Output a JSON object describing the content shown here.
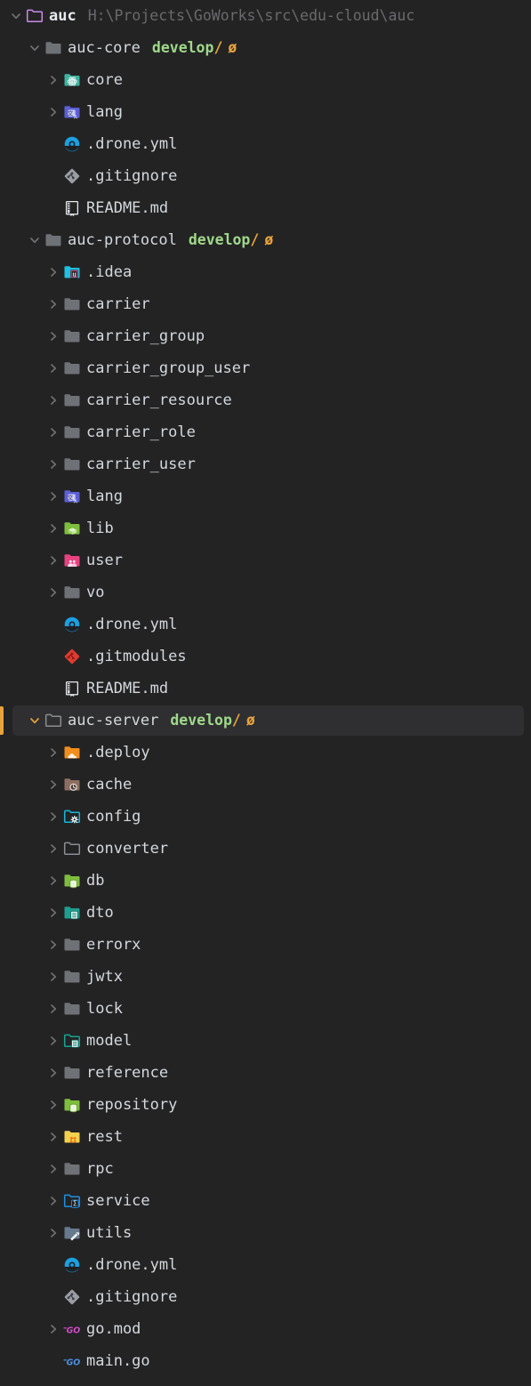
{
  "theme": {
    "background": "#232324",
    "selection_background": "#2F2F31",
    "selection_marker": "#E8A33D",
    "text": "#D5D8DC",
    "path_text": "#6A6A6C",
    "branch_name": "#9FD88A",
    "branch_slash": "#E8A33D",
    "chevron": "#707070"
  },
  "root": {
    "label": "auc",
    "path": "H:\\Projects\\GoWorks\\src\\edu-cloud\\auc",
    "icon": "folder-outline-purple-icon",
    "expanded": true
  },
  "branch_marker": "ø",
  "branch_separator": "/",
  "rows": [
    {
      "label": "auc",
      "path": "H:\\Projects\\GoWorks\\src\\edu-cloud\\auc",
      "indent": 0,
      "state": "expanded",
      "icon": "folder-outline-purple-icon",
      "bold": true,
      "selected": false
    },
    {
      "label": "auc-core",
      "branch": "develop",
      "indent": 1,
      "state": "expanded",
      "icon": "folder-gray-icon",
      "selected": false
    },
    {
      "label": "core",
      "indent": 2,
      "state": "collapsed",
      "icon": "folder-teal-atom-icon",
      "selected": false
    },
    {
      "label": "lang",
      "indent": 2,
      "state": "collapsed",
      "icon": "folder-indigo-translate-icon",
      "selected": false
    },
    {
      "label": ".drone.yml",
      "indent": 2,
      "state": "leaf",
      "icon": "drone-yml-icon",
      "selected": false
    },
    {
      "label": ".gitignore",
      "indent": 2,
      "state": "leaf",
      "icon": "git-gray-icon",
      "selected": false
    },
    {
      "label": "README.md",
      "indent": 2,
      "state": "leaf",
      "icon": "readme-book-icon",
      "selected": false
    },
    {
      "label": "auc-protocol",
      "branch": "develop",
      "indent": 1,
      "state": "expanded",
      "icon": "folder-gray-icon",
      "selected": false
    },
    {
      "label": ".idea",
      "indent": 2,
      "state": "collapsed",
      "icon": "folder-intellij-icon",
      "selected": false
    },
    {
      "label": "carrier",
      "indent": 2,
      "state": "collapsed",
      "icon": "folder-gray-icon",
      "selected": false
    },
    {
      "label": "carrier_group",
      "indent": 2,
      "state": "collapsed",
      "icon": "folder-gray-icon",
      "selected": false
    },
    {
      "label": "carrier_group_user",
      "indent": 2,
      "state": "collapsed",
      "icon": "folder-gray-icon",
      "selected": false
    },
    {
      "label": "carrier_resource",
      "indent": 2,
      "state": "collapsed",
      "icon": "folder-gray-icon",
      "selected": false
    },
    {
      "label": "carrier_role",
      "indent": 2,
      "state": "collapsed",
      "icon": "folder-gray-icon",
      "selected": false
    },
    {
      "label": "carrier_user",
      "indent": 2,
      "state": "collapsed",
      "icon": "folder-gray-icon",
      "selected": false
    },
    {
      "label": "lang",
      "indent": 2,
      "state": "collapsed",
      "icon": "folder-indigo-translate-icon",
      "selected": false
    },
    {
      "label": "lib",
      "indent": 2,
      "state": "collapsed",
      "icon": "folder-green-lib-icon",
      "selected": false
    },
    {
      "label": "user",
      "indent": 2,
      "state": "collapsed",
      "icon": "folder-pink-user-icon",
      "selected": false
    },
    {
      "label": "vo",
      "indent": 2,
      "state": "collapsed",
      "icon": "folder-gray-icon",
      "selected": false
    },
    {
      "label": ".drone.yml",
      "indent": 2,
      "state": "leaf",
      "icon": "drone-yml-icon",
      "selected": false
    },
    {
      "label": ".gitmodules",
      "indent": 2,
      "state": "leaf",
      "icon": "git-red-icon",
      "selected": false
    },
    {
      "label": "README.md",
      "indent": 2,
      "state": "leaf",
      "icon": "readme-book-icon",
      "selected": false
    },
    {
      "label": "auc-server",
      "branch": "develop",
      "indent": 1,
      "state": "expanded",
      "icon": "folder-outline-gray-icon",
      "selected": true
    },
    {
      "label": ".deploy",
      "indent": 2,
      "state": "collapsed",
      "icon": "folder-orange-cloud-icon",
      "selected": false
    },
    {
      "label": "cache",
      "indent": 2,
      "state": "collapsed",
      "icon": "folder-brown-clock-icon",
      "selected": false
    },
    {
      "label": "config",
      "indent": 2,
      "state": "collapsed",
      "icon": "folder-cyan-gear-icon",
      "selected": false
    },
    {
      "label": "converter",
      "indent": 2,
      "state": "collapsed",
      "icon": "folder-outline-gray-icon",
      "selected": false
    },
    {
      "label": "db",
      "indent": 2,
      "state": "collapsed",
      "icon": "folder-green-db-icon",
      "selected": false
    },
    {
      "label": "dto",
      "indent": 2,
      "state": "collapsed",
      "icon": "folder-teal-card-icon",
      "selected": false
    },
    {
      "label": "errorx",
      "indent": 2,
      "state": "collapsed",
      "icon": "folder-gray-icon",
      "selected": false
    },
    {
      "label": "jwtx",
      "indent": 2,
      "state": "collapsed",
      "icon": "folder-gray-icon",
      "selected": false
    },
    {
      "label": "lock",
      "indent": 2,
      "state": "collapsed",
      "icon": "folder-gray-icon",
      "selected": false
    },
    {
      "label": "model",
      "indent": 2,
      "state": "collapsed",
      "icon": "folder-teal-outline-card-icon",
      "selected": false
    },
    {
      "label": "reference",
      "indent": 2,
      "state": "collapsed",
      "icon": "folder-gray-icon",
      "selected": false
    },
    {
      "label": "repository",
      "indent": 2,
      "state": "collapsed",
      "icon": "folder-green-db-icon",
      "selected": false
    },
    {
      "label": "rest",
      "indent": 2,
      "state": "collapsed",
      "icon": "folder-yellow-rest-icon",
      "selected": false
    },
    {
      "label": "rpc",
      "indent": 2,
      "state": "collapsed",
      "icon": "folder-gray-icon",
      "selected": false
    },
    {
      "label": "service",
      "indent": 2,
      "state": "collapsed",
      "icon": "folder-blue-sigma-icon",
      "selected": false
    },
    {
      "label": "utils",
      "indent": 2,
      "state": "collapsed",
      "icon": "folder-slate-wrench-icon",
      "selected": false
    },
    {
      "label": ".drone.yml",
      "indent": 2,
      "state": "leaf",
      "icon": "drone-yml-icon",
      "selected": false
    },
    {
      "label": ".gitignore",
      "indent": 2,
      "state": "leaf",
      "icon": "git-gray-icon",
      "selected": false
    },
    {
      "label": "go.mod",
      "indent": 2,
      "state": "collapsed",
      "icon": "go-mod-magenta-icon",
      "selected": false
    },
    {
      "label": "main.go",
      "indent": 2,
      "state": "leaf",
      "icon": "go-blue-icon",
      "selected": false
    }
  ]
}
